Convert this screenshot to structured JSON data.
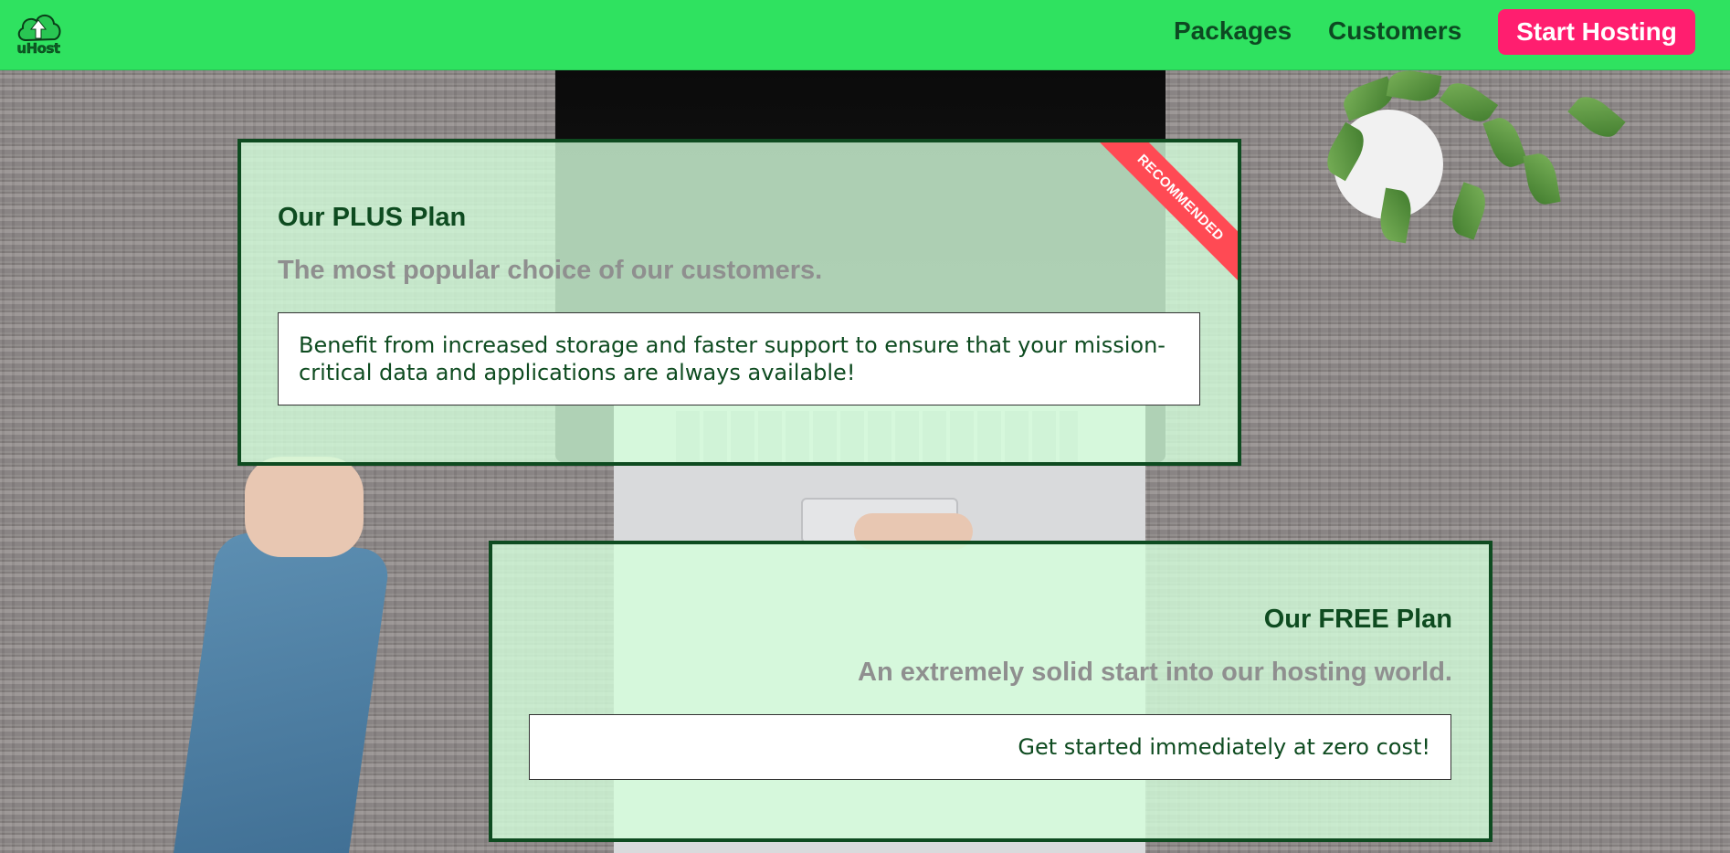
{
  "header": {
    "logo_text": "uHost",
    "nav": {
      "packages": "Packages",
      "customers": "Customers"
    },
    "cta_label": "Start Hosting"
  },
  "plans": [
    {
      "title": "Our PLUS Plan",
      "subtitle": "The most popular choice of our customers.",
      "description": "Benefit from increased storage and faster support to ensure that your mission-critical data and applications are always available!",
      "badge": "RECOMMENDED"
    },
    {
      "title": "Our FREE Plan",
      "subtitle": "An extremely solid start into our hosting world.",
      "description": "Get started immediately at zero cost!"
    }
  ],
  "colors": {
    "header_bg": "#2fe260",
    "nav_text": "#0d4a22",
    "cta_bg": "#ff1e6f",
    "card_border": "#0e4b20",
    "card_bg": "#d5ffdc",
    "badge_bg": "#ff4a54",
    "subtitle_text": "#8f8f8f"
  }
}
